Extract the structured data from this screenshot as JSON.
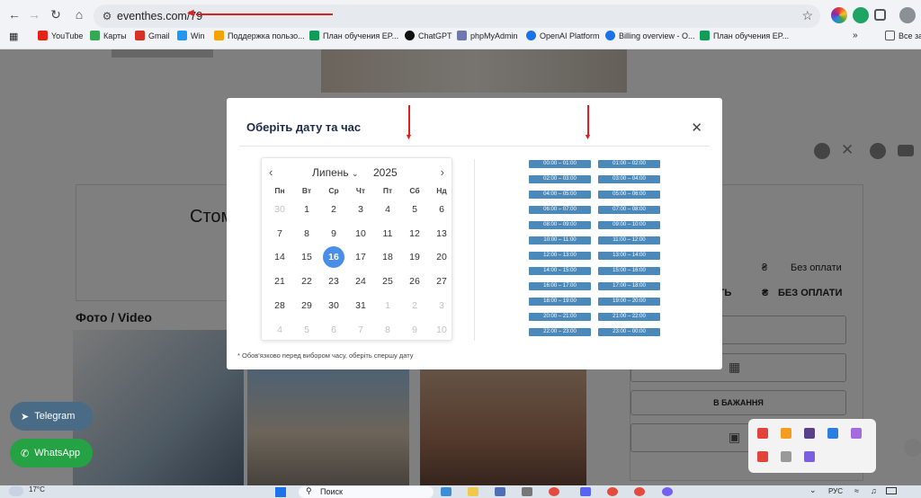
{
  "browser": {
    "url": "eventhes.com/79",
    "bookmarks": [
      "YouTube",
      "Карты",
      "Gmail",
      "Win",
      "Поддержка пользо...",
      "План обучения EP...",
      "ChatGPT",
      "phpMyAdmin",
      "OpenAI Platform",
      "Billing overview - O...",
      "План обучения EP..."
    ],
    "all_bookmarks": "Все зак",
    "bookmark_colors": [
      "#e62117",
      "#34a853",
      "#d93025",
      "#2196f3",
      "#f4a300",
      "#0f9d58",
      "#111111",
      "#6c78af",
      "#1a73e8",
      "#1a73e8",
      "#0f9d58"
    ]
  },
  "background_page": {
    "heading_partial": "Стом",
    "photo_section_title": "Фото / Video",
    "price_currency": "₴",
    "price_text": "Без оплати",
    "price_row_partial": "СТЬ",
    "price_row_value": "БЕЗ ОПЛАТИ",
    "wishlist_button": "В БАЖАННЯ",
    "telegram_button": "Telegram",
    "whatsapp_button": "WhatsApp"
  },
  "modal": {
    "title": "Оберіть дату та час",
    "close_icon": "close-icon",
    "note": "* Обов'язково перед вибором часу, оберіть спершу дату"
  },
  "calendar": {
    "month": "Липень",
    "year": "2025",
    "weekdays": [
      "Пн",
      "Вт",
      "Ср",
      "Чт",
      "Пт",
      "Сб",
      "Нд"
    ],
    "weeks": [
      [
        "30",
        "1",
        "2",
        "3",
        "4",
        "5",
        "6"
      ],
      [
        "7",
        "8",
        "9",
        "10",
        "11",
        "12",
        "13"
      ],
      [
        "14",
        "15",
        "16",
        "17",
        "18",
        "19",
        "20"
      ],
      [
        "21",
        "22",
        "23",
        "24",
        "25",
        "26",
        "27"
      ],
      [
        "28",
        "29",
        "30",
        "31",
        "1",
        "2",
        "3"
      ],
      [
        "4",
        "5",
        "6",
        "7",
        "8",
        "9",
        "10"
      ]
    ],
    "selected_day": "16",
    "selected_color": "#4a8fe7"
  },
  "time_slots": [
    "00:00 – 01:00",
    "01:00 – 02:00",
    "02:00 – 03:00",
    "03:00 – 04:00",
    "04:00 – 05:00",
    "05:00 – 06:00",
    "06:00 – 07:00",
    "07:00 – 08:00",
    "08:00 – 09:00",
    "09:00 – 10:00",
    "10:00 – 11:00",
    "11:00 – 12:00",
    "12:00 – 13:00",
    "13:00 – 14:00",
    "14:00 – 15:00",
    "15:00 – 16:00",
    "16:00 – 17:00",
    "17:00 – 18:00",
    "18:00 – 19:00",
    "19:00 – 20:00",
    "20:00 – 21:00",
    "21:00 – 22:00",
    "22:00 – 23:00",
    "23:00 – 00:00"
  ],
  "slot_color": "#4a89b9",
  "taskbar": {
    "weather_temp": "17°C",
    "search_placeholder": "Поиск",
    "language": "РУС"
  }
}
